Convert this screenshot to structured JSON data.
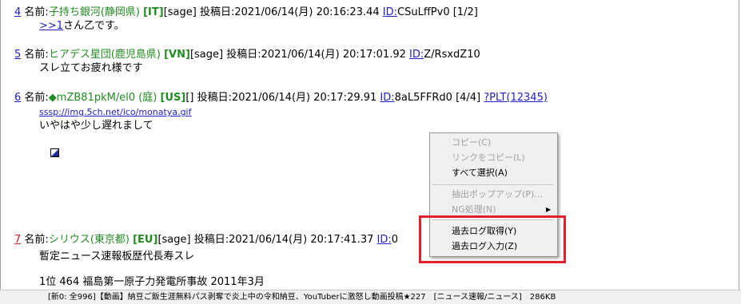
{
  "posts": [
    {
      "num": "4",
      "name_label": "名前:",
      "name": "子持ち銀河(静岡県)",
      "country": "[IT]",
      "mail": "[sage]",
      "date_label": "投稿日:",
      "date": "2021/06/14(月) 20:16:23.44",
      "id_label": "ID:",
      "id": "CSuLffPv0",
      "count": "[1/2]",
      "anchor": ">>1",
      "body": "さん乙です。"
    },
    {
      "num": "5",
      "name_label": "名前:",
      "name": "ヒアデス星団(鹿児島県)",
      "country": "[VN]",
      "mail": "[sage]",
      "date_label": "投稿日:",
      "date": "2021/06/14(月) 20:17:01.92",
      "id_label": "ID:",
      "id": "Z/RsxdZ10",
      "body": "スレ立てお疲れ様です"
    },
    {
      "num": "6",
      "name_label": "名前:",
      "name": "◆mZB81pkM/el0 (庭)",
      "country": "[US]",
      "mail": "[]",
      "date_label": "投稿日:",
      "date": "2021/06/14(月) 20:17:29.91",
      "id_label": "ID:",
      "id": "8aL5FFRd0",
      "count": "[4/4]",
      "plt": "?PLT(12345)",
      "image_link": "sssp://img.5ch.net/ico/monatya.gif",
      "body": "いやはや少し遅れまして"
    },
    {
      "num": "7",
      "name_label": "名前:",
      "name": "シリウス(東京都)",
      "country": "[EU]",
      "mail": "[sage]",
      "date_label": "投稿日:",
      "date": "2021/06/14(月) 20:17:41.37",
      "id_label": "ID:",
      "id": "0",
      "body": "暫定ニュース速報板歴代長寿スレ",
      "body2": "1位 464 福島第一原子力発電所事故 2011年3月"
    }
  ],
  "context_menu": {
    "items": [
      {
        "label": "コピー(C)",
        "disabled": true
      },
      {
        "label": "リンクをコピー(L)",
        "disabled": true
      },
      {
        "label": "すべて選択(A)",
        "disabled": false
      },
      {
        "label": "抽出ポップアップ(P)...",
        "disabled": true
      },
      {
        "label": "NG処理(N)",
        "disabled": true
      },
      {
        "label": "過去ログ取得(Y)",
        "disabled": false
      },
      {
        "label": "過去ログ入力(Z)",
        "disabled": false
      }
    ]
  },
  "status_bar": {
    "text": "[新0: 全996]【動画】納豆ご飯生涯無料パス剥奪で炎上中の令和納豆、YouTuberに激怒し動画投稿★227　[ニュース速報/ニュース]　286KB"
  },
  "colors": {
    "name_green": "#228b22",
    "link_blue": "#1e1ec8",
    "highlight_red": "#e0202a"
  }
}
